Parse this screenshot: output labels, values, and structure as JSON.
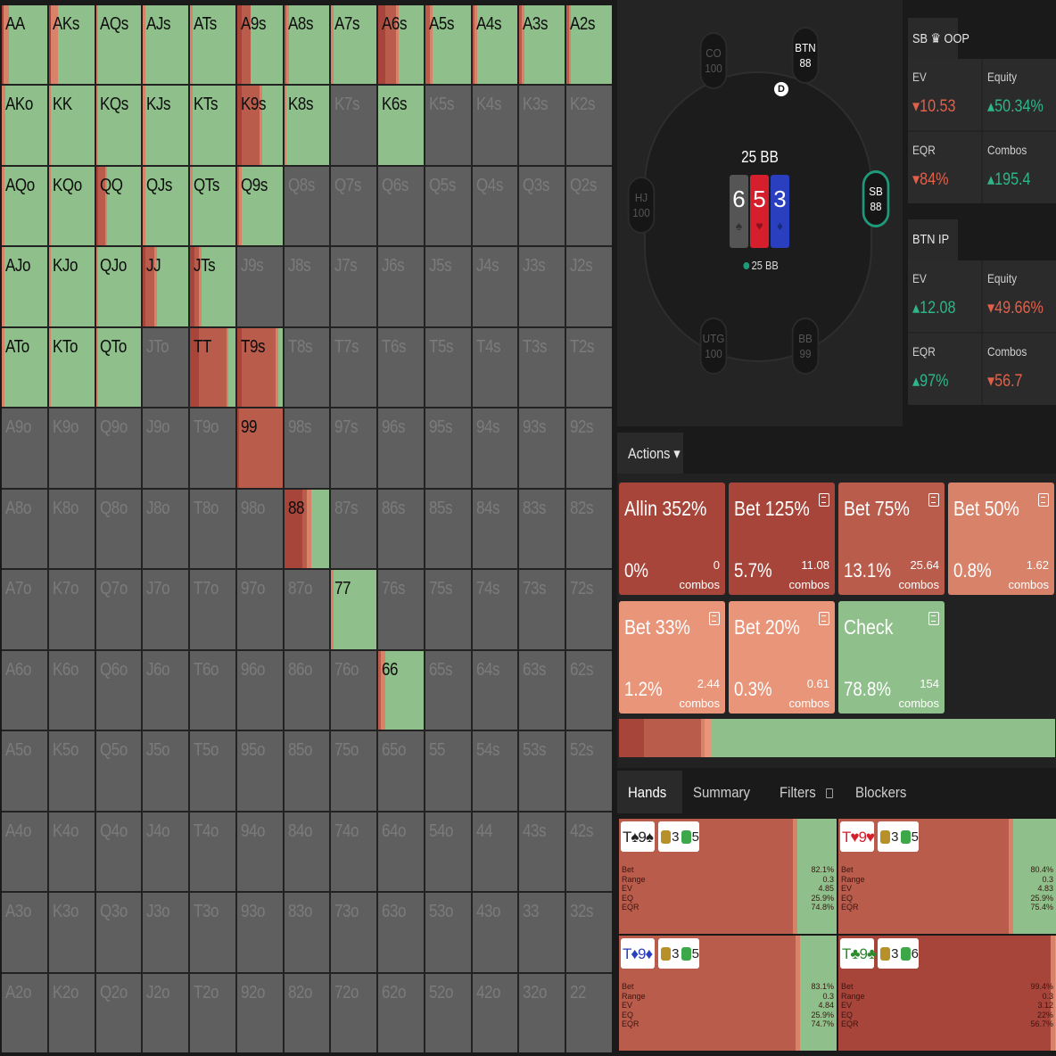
{
  "colors": {
    "green": "#8fc08b",
    "inactive": "#5f5f5f",
    "red_dark": "#a8453a",
    "red_mid": "#b95c4c",
    "red_light": "#d8826a",
    "salmon": "#e8957a"
  },
  "matrix": {
    "rows": [
      [
        "AA",
        "AKs",
        "AQs",
        "AJs",
        "ATs",
        "A9s",
        "A8s",
        "A7s",
        "A6s",
        "A5s",
        "A4s",
        "A3s",
        "A2s"
      ],
      [
        "AKo",
        "KK",
        "KQs",
        "KJs",
        "KTs",
        "K9s",
        "K8s",
        "K7s",
        "K6s",
        "K5s",
        "K4s",
        "K3s",
        "K2s"
      ],
      [
        "AQo",
        "KQo",
        "QQ",
        "QJs",
        "QTs",
        "Q9s",
        "Q8s",
        "Q7s",
        "Q6s",
        "Q5s",
        "Q4s",
        "Q3s",
        "Q2s"
      ],
      [
        "AJo",
        "KJo",
        "QJo",
        "JJ",
        "JTs",
        "J9s",
        "J8s",
        "J7s",
        "J6s",
        "J5s",
        "J4s",
        "J3s",
        "J2s"
      ],
      [
        "ATo",
        "KTo",
        "QTo",
        "JTo",
        "TT",
        "T9s",
        "T8s",
        "T7s",
        "T6s",
        "T5s",
        "T4s",
        "T3s",
        "T2s"
      ],
      [
        "A9o",
        "K9o",
        "Q9o",
        "J9o",
        "T9o",
        "99",
        "98s",
        "97s",
        "96s",
        "95s",
        "94s",
        "93s",
        "92s"
      ],
      [
        "A8o",
        "K8o",
        "Q8o",
        "J8o",
        "T8o",
        "98o",
        "88",
        "87s",
        "86s",
        "85s",
        "84s",
        "83s",
        "82s"
      ],
      [
        "A7o",
        "K7o",
        "Q7o",
        "J7o",
        "T7o",
        "97o",
        "87o",
        "77",
        "76s",
        "75s",
        "74s",
        "73s",
        "72s"
      ],
      [
        "A6o",
        "K6o",
        "Q6o",
        "J6o",
        "T6o",
        "96o",
        "86o",
        "76o",
        "66",
        "65s",
        "64s",
        "63s",
        "62s"
      ],
      [
        "A5o",
        "K5o",
        "Q5o",
        "J5o",
        "T5o",
        "95o",
        "85o",
        "75o",
        "65o",
        "55",
        "54s",
        "53s",
        "52s"
      ],
      [
        "A4o",
        "K4o",
        "Q4o",
        "J4o",
        "T4o",
        "94o",
        "84o",
        "74o",
        "64o",
        "54o",
        "44",
        "43s",
        "42s"
      ],
      [
        "A3o",
        "K3o",
        "Q3o",
        "J3o",
        "T3o",
        "93o",
        "83o",
        "73o",
        "63o",
        "53o",
        "43o",
        "33",
        "32s"
      ],
      [
        "A2o",
        "K2o",
        "Q2o",
        "J2o",
        "T2o",
        "92o",
        "82o",
        "72o",
        "62o",
        "52o",
        "42o",
        "32o",
        "22"
      ]
    ],
    "frequencies": {
      "AA": [
        0,
        0.03,
        0,
        0.12,
        0,
        0.85
      ],
      "AKs": [
        0,
        0.05,
        0,
        0.15,
        0,
        0.8
      ],
      "AQs": [
        0,
        0,
        0,
        0.05,
        0,
        0.95
      ],
      "AJs": [
        0,
        0,
        0,
        0.05,
        0,
        0.95
      ],
      "ATs": [
        0,
        0,
        0,
        0.05,
        0,
        0.95
      ],
      "A9s": [
        0,
        0.1,
        0.2,
        0,
        0,
        0.7
      ],
      "A8s": [
        0,
        0,
        0.05,
        0.05,
        0,
        0.9
      ],
      "A7s": [
        0,
        0,
        0,
        0.05,
        0,
        0.95
      ],
      "A6s": [
        0,
        0.15,
        0.25,
        0.05,
        0,
        0.55
      ],
      "A5s": [
        0,
        0,
        0.1,
        0.05,
        0,
        0.85
      ],
      "A4s": [
        0,
        0,
        0.05,
        0.05,
        0,
        0.9
      ],
      "A3s": [
        0,
        0,
        0.05,
        0.05,
        0,
        0.9
      ],
      "A2s": [
        0,
        0,
        0.05,
        0.05,
        0,
        0.9
      ],
      "AKo": [
        0,
        0,
        0,
        0.08,
        0,
        0.92
      ],
      "KK": [
        0,
        0,
        0,
        0.05,
        0,
        0.95
      ],
      "KQs": [
        0,
        0,
        0,
        0.05,
        0,
        0.95
      ],
      "KJs": [
        0,
        0,
        0,
        0.05,
        0,
        0.95
      ],
      "KTs": [
        0,
        0,
        0,
        0.05,
        0,
        0.95
      ],
      "K9s": [
        0,
        0.1,
        0.4,
        0.05,
        0,
        0.45
      ],
      "K8s": [
        0,
        0,
        0,
        0.05,
        0,
        0.95
      ],
      "K6s": [
        0,
        0,
        0,
        0,
        0,
        1
      ],
      "AQo": [
        0,
        0,
        0,
        0.05,
        0,
        0.95
      ],
      "KQo": [
        0,
        0,
        0,
        0.05,
        0,
        0.95
      ],
      "QQ": [
        0,
        0.05,
        0.15,
        0.05,
        0,
        0.75
      ],
      "QJs": [
        0,
        0,
        0,
        0.05,
        0,
        0.95
      ],
      "QTs": [
        0,
        0,
        0,
        0.05,
        0,
        0.95
      ],
      "Q9s": [
        0,
        0,
        0.05,
        0.05,
        0,
        0.9
      ],
      "AJo": [
        0,
        0,
        0,
        0.05,
        0,
        0.95
      ],
      "KJo": [
        0,
        0,
        0,
        0.05,
        0,
        0.95
      ],
      "QJo": [
        0,
        0,
        0,
        0.05,
        0,
        0.95
      ],
      "JJ": [
        0,
        0.05,
        0.2,
        0.05,
        0,
        0.7
      ],
      "JTs": [
        0,
        0.1,
        0.1,
        0.05,
        0,
        0.75
      ],
      "ATo": [
        0,
        0,
        0,
        0.05,
        0,
        0.95
      ],
      "KTo": [
        0,
        0,
        0,
        0.05,
        0,
        0.95
      ],
      "QTo": [
        0,
        0,
        0,
        0.05,
        0,
        0.95
      ],
      "TT": [
        0,
        0.2,
        0.6,
        0.05,
        0,
        0.15
      ],
      "T9s": [
        0,
        0.1,
        0.75,
        0.05,
        0,
        0.1
      ],
      "99": [
        0,
        0.05,
        0.95,
        0,
        0,
        0
      ],
      "88": [
        0,
        0.4,
        0.1,
        0.1,
        0,
        0.4
      ],
      "77": [
        0,
        0,
        0,
        0.05,
        0,
        0.95
      ],
      "66": [
        0,
        0,
        0.05,
        0.1,
        0,
        0.85
      ]
    }
  },
  "table": {
    "seats": [
      {
        "pos": "CO",
        "stack": "100",
        "active": false
      },
      {
        "pos": "BTN",
        "stack": "88",
        "active": true
      },
      {
        "pos": "HJ",
        "stack": "100",
        "active": false
      },
      {
        "pos": "SB",
        "stack": "88",
        "active": true,
        "hero": true
      },
      {
        "pos": "UTG",
        "stack": "100",
        "active": false
      },
      {
        "pos": "BB",
        "stack": "99",
        "active": false
      }
    ],
    "dealer": "D",
    "pot": "25 BB",
    "board": [
      {
        "rank": "6",
        "suit": "♠",
        "color": "#555555"
      },
      {
        "rank": "5",
        "suit": "♥",
        "color": "#d61f2c"
      },
      {
        "rank": "3",
        "suit": "♦",
        "color": "#2a3fbf"
      }
    ],
    "stack_label": "25 BB"
  },
  "stats": {
    "oop": {
      "title": "SB ♛ OOP",
      "ev_label": "EV",
      "ev": "▾10.53",
      "equity_label": "Equity",
      "equity": "▴50.34%",
      "eqr_label": "EQR",
      "eqr": "▾84%",
      "combos_label": "Combos",
      "combos": "▴195.4"
    },
    "ip": {
      "title": "BTN IP",
      "ev_label": "EV",
      "ev": "▴12.08",
      "equity_label": "Equity",
      "equity": "▾49.66%",
      "eqr_label": "EQR",
      "eqr": "▴97%",
      "combos_label": "Combos",
      "combos": "▾56.7"
    }
  },
  "actions": {
    "tab_label": "Actions ▾",
    "items": [
      {
        "name": "Allin 352%",
        "pct": "0%",
        "combos": "0",
        "combos_label": "combos",
        "color": "#a8453a",
        "note": false
      },
      {
        "name": "Bet 125%",
        "pct": "5.7%",
        "combos": "11.08",
        "combos_label": "combos",
        "color": "#a8453a",
        "note": true
      },
      {
        "name": "Bet 75%",
        "pct": "13.1%",
        "combos": "25.64",
        "combos_label": "combos",
        "color": "#b95c4c",
        "note": true
      },
      {
        "name": "Bet 50%",
        "pct": "0.8%",
        "combos": "1.62",
        "combos_label": "combos",
        "color": "#d8826a",
        "note": true
      },
      {
        "name": "Bet 33%",
        "pct": "1.2%",
        "combos": "2.44",
        "combos_label": "combos",
        "color": "#e8957a",
        "note": true
      },
      {
        "name": "Bet 20%",
        "pct": "0.3%",
        "combos": "0.61",
        "combos_label": "combos",
        "color": "#e8957a",
        "note": true
      },
      {
        "name": "Check",
        "pct": "78.8%",
        "combos": "154",
        "combos_label": "combos",
        "color": "#8fc08b",
        "note": true
      }
    ],
    "mix": [
      0.057,
      0.131,
      0.008,
      0.012,
      0.003,
      0.788
    ]
  },
  "hand_tabs": {
    "hands": "Hands",
    "summary": "Summary",
    "filters": "Filters",
    "blockers": "Blockers"
  },
  "hands": [
    {
      "combo": "T♠9♠",
      "c1": "#222222",
      "b1": "3",
      "b2": "5",
      "bet_pct": 0.821,
      "labels": [
        "Bet",
        "Range",
        "EV",
        "EQ",
        "EQR"
      ],
      "values": [
        "82.1%",
        "0.3",
        "4.85",
        "25.9%",
        "74.8%"
      ]
    },
    {
      "combo": "T♥9♥",
      "c1": "#d61f2c",
      "b1": "3",
      "b2": "5",
      "bet_pct": 0.804,
      "labels": [
        "Bet",
        "Range",
        "EV",
        "EQ",
        "EQR"
      ],
      "values": [
        "80.4%",
        "0.3",
        "4.83",
        "25.9%",
        "75.4%"
      ]
    },
    {
      "combo": "T♦9♦",
      "c1": "#2a3fbf",
      "b1": "3",
      "b2": "5",
      "bet_pct": 0.831,
      "labels": [
        "Bet",
        "Range",
        "EV",
        "EQ",
        "EQR"
      ],
      "values": [
        "83.1%",
        "0.3",
        "4.84",
        "25.9%",
        "74.7%"
      ]
    },
    {
      "combo": "T♣9♣",
      "c1": "#2c8a2c",
      "b1": "3",
      "b2": "6",
      "bet_pct": 0.994,
      "labels": [
        "Bet",
        "Range",
        "EV",
        "EQ",
        "EQR"
      ],
      "values": [
        "99.4%",
        "0.3",
        "3.12",
        "22%",
        "56.7%"
      ]
    }
  ]
}
